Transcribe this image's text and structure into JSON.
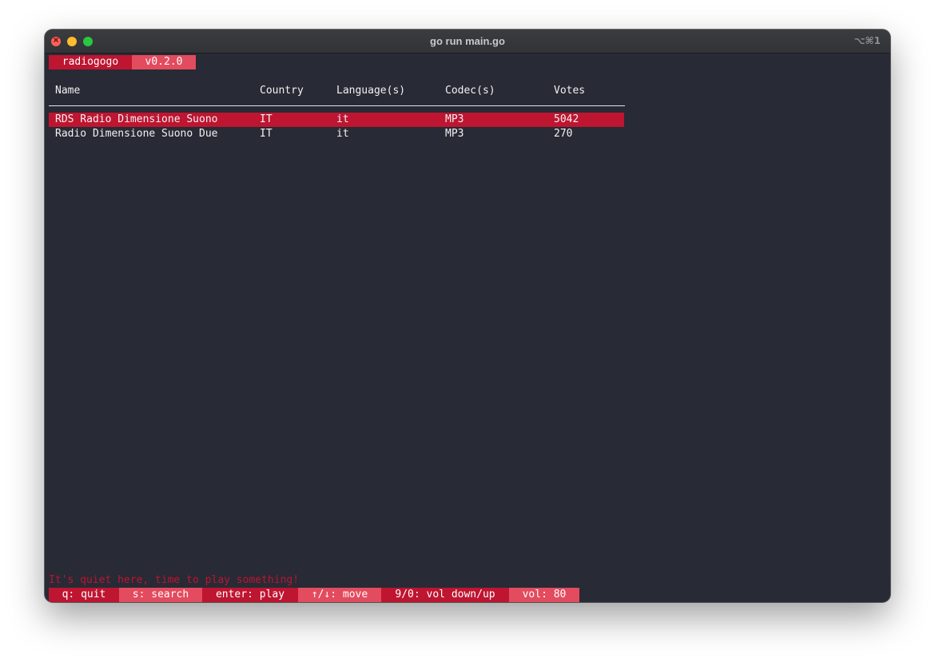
{
  "window": {
    "title": "go run main.go",
    "shortcut": "⌥⌘1"
  },
  "app": {
    "name": "radiogogo",
    "version": "v0.2.0"
  },
  "table": {
    "columns": [
      "Name",
      "Country",
      "Language(s)",
      "Codec(s)",
      "Votes"
    ],
    "rows": [
      {
        "name": "RDS Radio Dimensione Suono",
        "country": "IT",
        "language": "it",
        "codec": "MP3",
        "votes": "5042",
        "selected": true
      },
      {
        "name": "Radio Dimensione Suono Due",
        "country": "IT",
        "language": "it",
        "codec": "MP3",
        "votes": "270",
        "selected": false
      }
    ]
  },
  "status_message": "It's quiet here, time to play something!",
  "keybinds": [
    {
      "label": "q: quit"
    },
    {
      "label": "s: search"
    },
    {
      "label": "enter: play"
    },
    {
      "label": "↑/↓: move"
    },
    {
      "label": "9/0: vol down/up"
    },
    {
      "label": "vol: 80"
    }
  ],
  "colors": {
    "terminal_bg": "#282a35",
    "accent_dark": "#be1531",
    "accent_light": "#e34b5e",
    "text": "#f2f2f2"
  }
}
